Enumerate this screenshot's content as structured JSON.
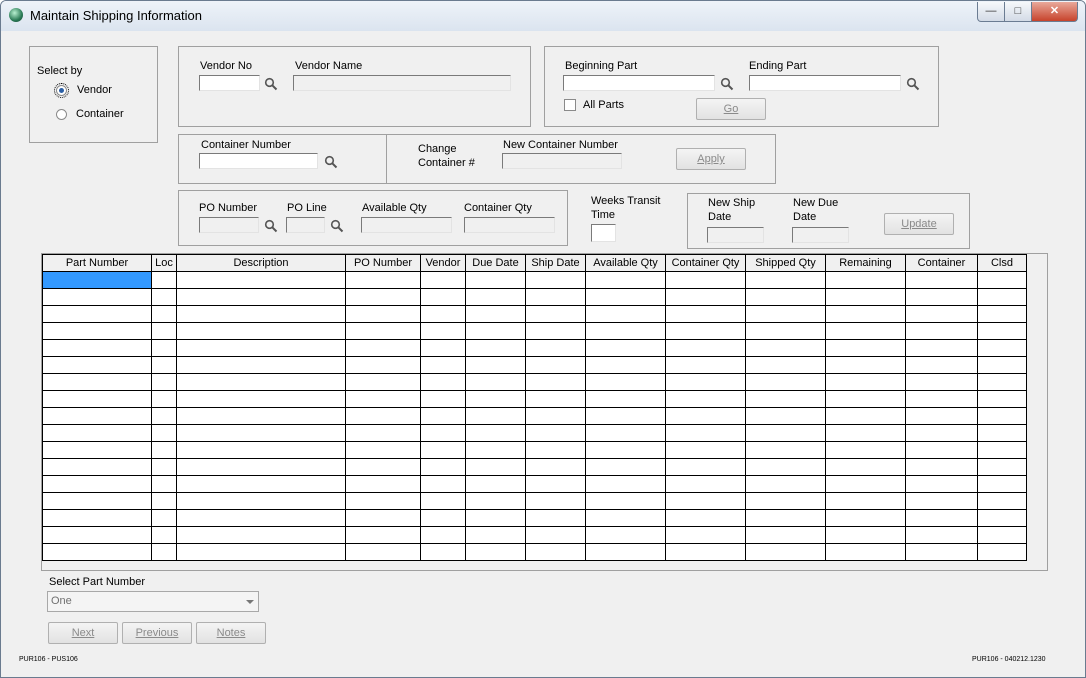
{
  "window": {
    "title": "Maintain Shipping Information",
    "minimize": "—",
    "maximize": "□",
    "close": "✕"
  },
  "select_by": {
    "label": "Select by",
    "options": [
      "Vendor",
      "Container"
    ],
    "selected": "Vendor"
  },
  "vendor": {
    "no_label": "Vendor No",
    "no_value": "",
    "name_label": "Vendor Name",
    "name_value": ""
  },
  "parts": {
    "beginning_label": "Beginning Part",
    "beginning_value": "",
    "ending_label": "Ending Part",
    "ending_value": "",
    "all_parts_label": "All Parts",
    "all_parts_checked": false,
    "go_label": "Go"
  },
  "container": {
    "number_label": "Container Number",
    "number_value": "",
    "change_label_1": "Change",
    "change_label_2": "Container #",
    "new_number_label": "New Container Number",
    "new_number_value": "",
    "apply_label": "Apply"
  },
  "po": {
    "number_label": "PO Number",
    "line_label": "PO Line",
    "available_label": "Available Qty",
    "container_qty_label": "Container Qty"
  },
  "transit": {
    "label_1": "Weeks Transit",
    "label_2": "Time",
    "value": ""
  },
  "dates": {
    "ship_label_1": "New Ship",
    "ship_label_2": "Date",
    "due_label_1": "New Due",
    "due_label_2": "Date",
    "update_label": "Update"
  },
  "grid": {
    "columns": [
      "Part Number",
      "Loc",
      "Description",
      "PO Number",
      "Vendor",
      "Due Date",
      "Ship Date",
      "Available Qty",
      "Container Qty",
      "Shipped Qty",
      "Remaining",
      "Container",
      "Clsd"
    ],
    "row_count": 17,
    "selected_row": 0
  },
  "select_part": {
    "label": "Select Part Number",
    "value": "One"
  },
  "nav": {
    "next": "Next",
    "previous": "Previous",
    "notes": "Notes"
  },
  "footer": {
    "left": "PUR106 - PUS106",
    "right": "PUR106 - 040212.1230"
  }
}
